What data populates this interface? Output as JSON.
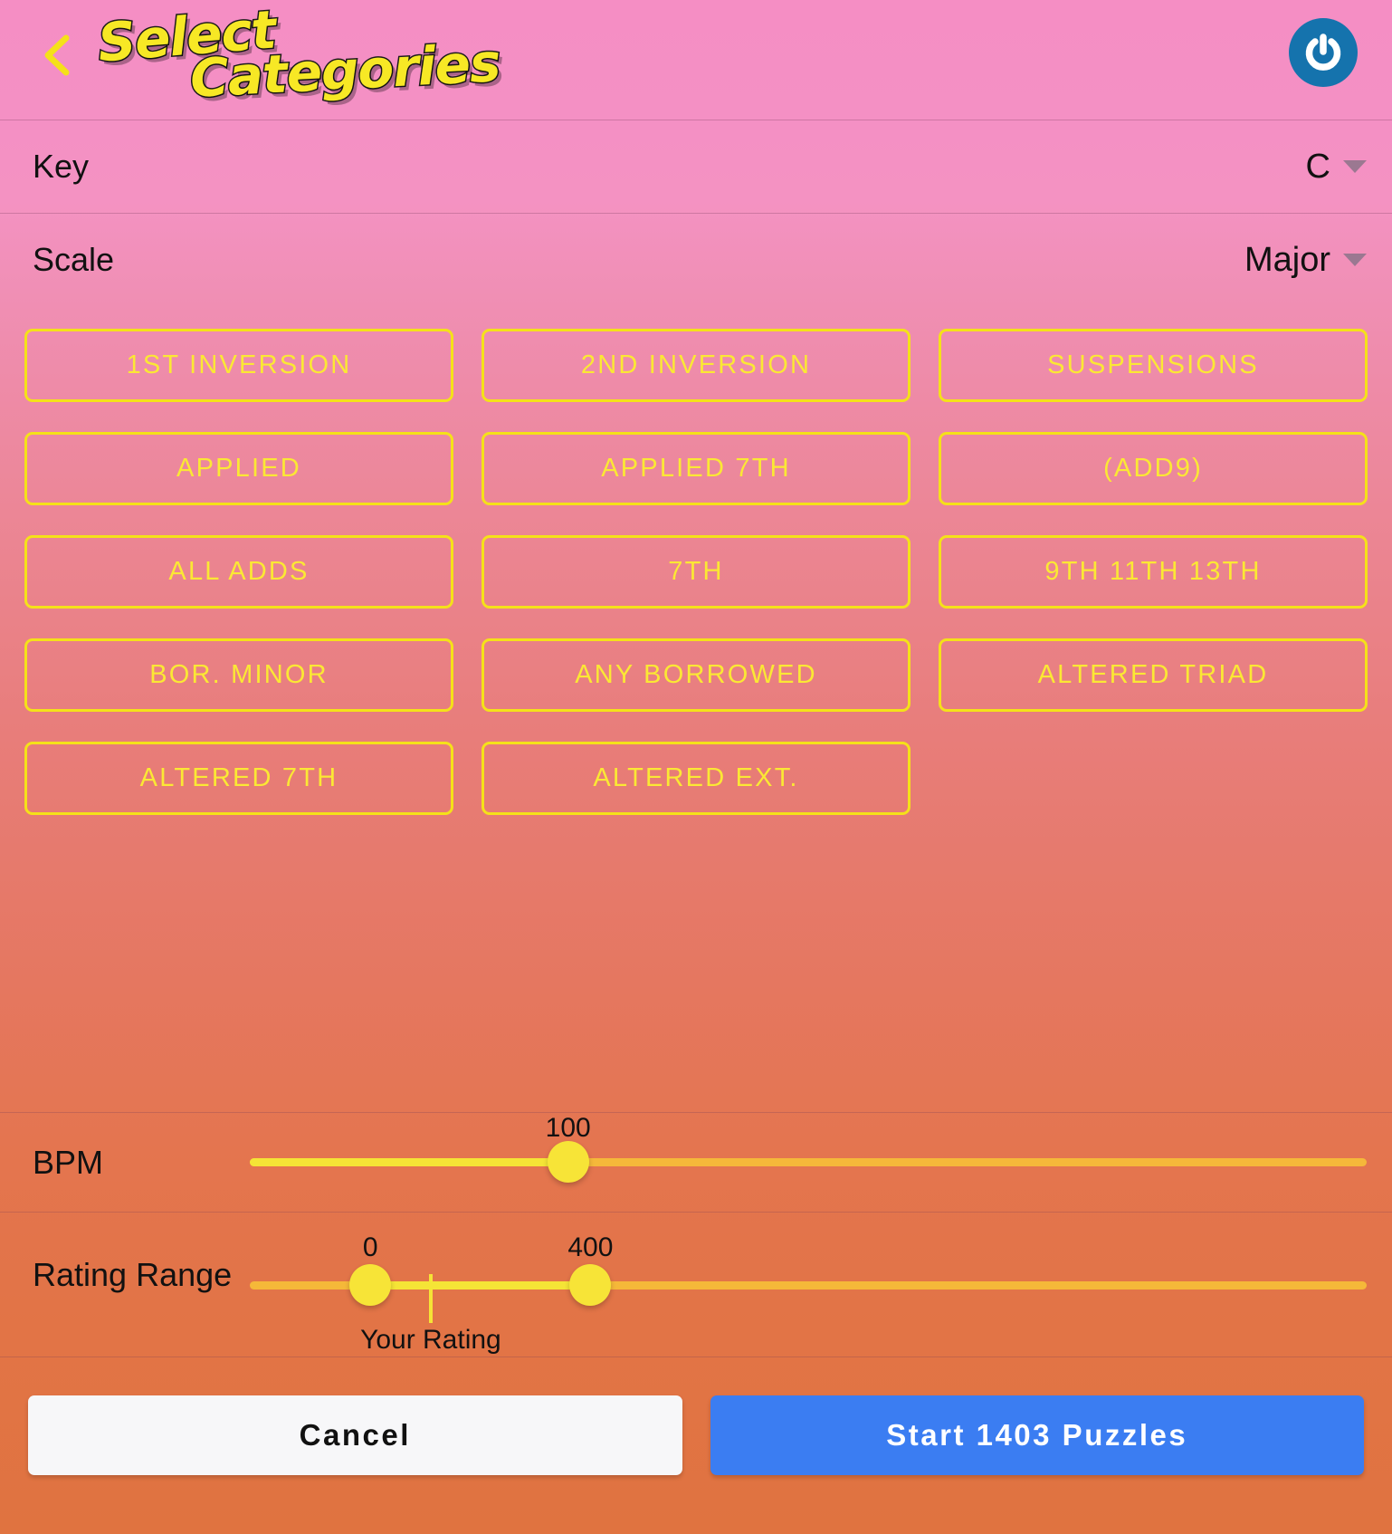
{
  "header": {
    "back_icon": "chevron-left-icon",
    "title_line1": "Select",
    "title_line2": "Categories",
    "power_icon": "power-icon"
  },
  "selects": [
    {
      "label": "Key",
      "value": "C",
      "caret_icon": "chevron-down-icon"
    },
    {
      "label": "Scale",
      "value": "Major",
      "caret_icon": "chevron-down-icon"
    }
  ],
  "categories": [
    {
      "label": "1st Inversion",
      "selected": false
    },
    {
      "label": "2nd Inversion",
      "selected": false
    },
    {
      "label": "Suspensions",
      "selected": false
    },
    {
      "label": "Applied",
      "selected": false
    },
    {
      "label": "Applied 7th",
      "selected": false
    },
    {
      "label": "(Add9)",
      "selected": false
    },
    {
      "label": "All Adds",
      "selected": false
    },
    {
      "label": "7th",
      "selected": false
    },
    {
      "label": "9th 11th 13th",
      "selected": false
    },
    {
      "label": "Bor. Minor",
      "selected": false
    },
    {
      "label": "Any Borrowed",
      "selected": false
    },
    {
      "label": "Altered Triad",
      "selected": false
    },
    {
      "label": "Altered 7th",
      "selected": false
    },
    {
      "label": "Altered Ext.",
      "selected": false
    }
  ],
  "bpm": {
    "label": "BPM",
    "value": "100",
    "fill_percent": 28.5,
    "thumb_percent": 28.5
  },
  "rating": {
    "label": "Rating Range",
    "min_value": "0",
    "max_value": "400",
    "min_percent": 10.8,
    "max_percent": 30.5,
    "tick_percent": 16.2,
    "tick_label": "Your Rating"
  },
  "footer": {
    "cancel_label": "Cancel",
    "start_label": "Start 1403 Puzzles"
  },
  "colors": {
    "accent_yellow": "#f5e119",
    "start_blue": "#3b7df2",
    "power_blue": "#1573ad",
    "bg_top_pink": "#f58ec4",
    "bg_bottom_orange": "#e07340"
  }
}
